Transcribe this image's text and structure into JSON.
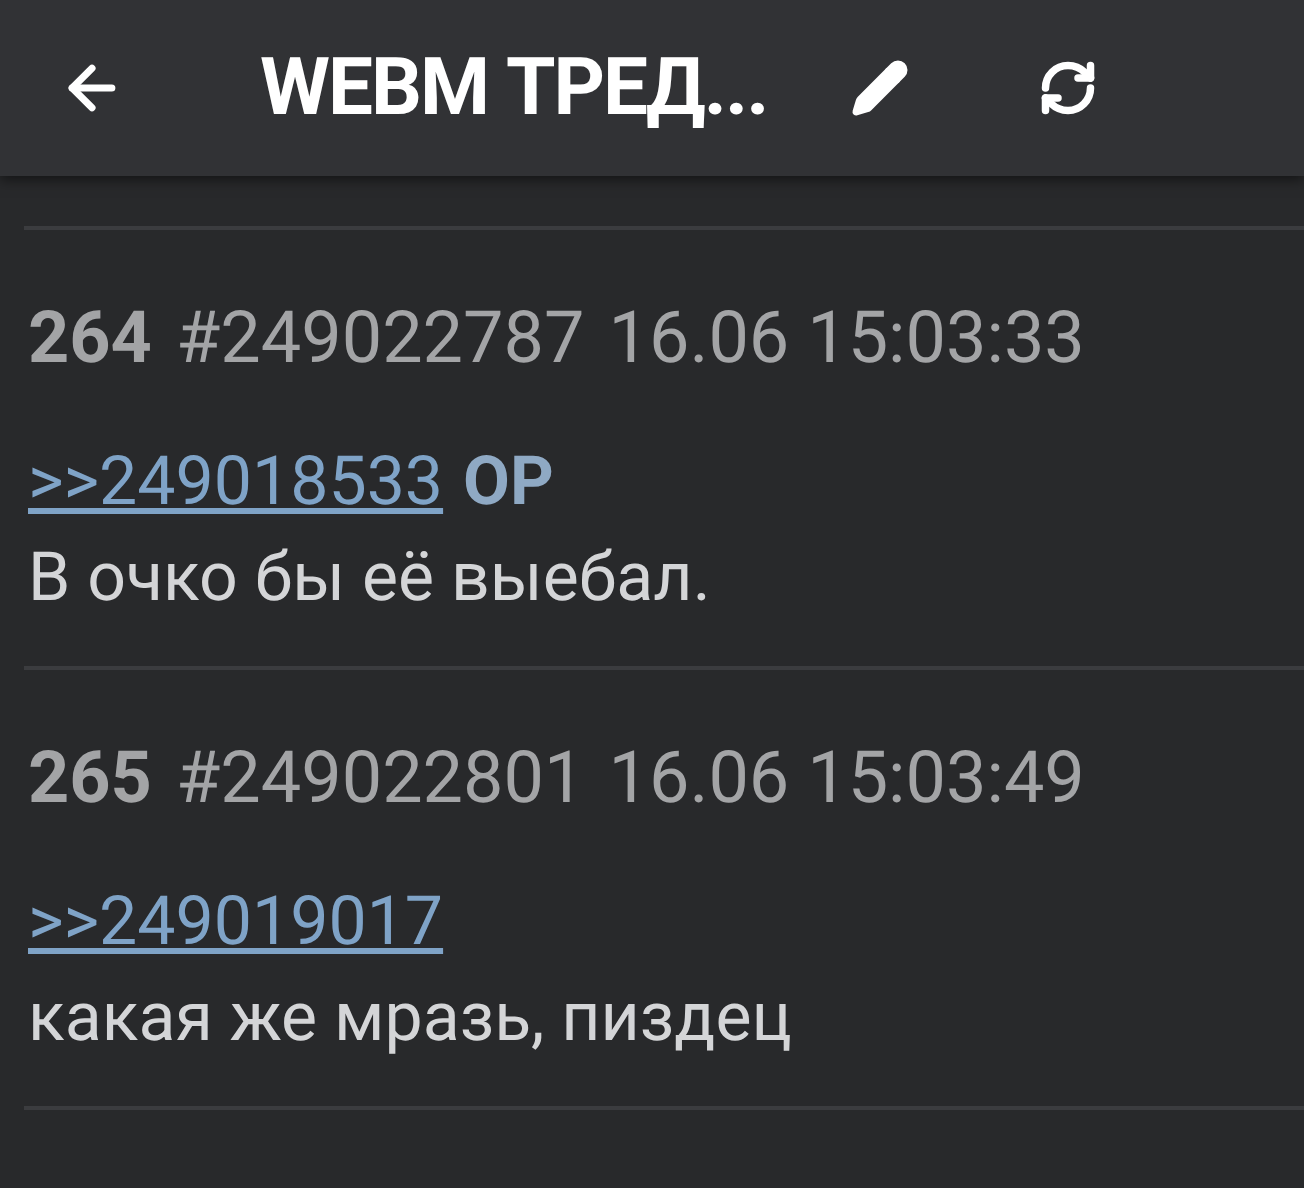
{
  "toolbar": {
    "title": "WEBM ТРЕД..."
  },
  "posts": [
    {
      "number": "264",
      "id": "#249022787",
      "date": "16.06 15:03:33",
      "reply_link": ">>249018533",
      "op_mark": "OP",
      "text": "В очко бы её выебал."
    },
    {
      "number": "265",
      "id": "#249022801",
      "date": "16.06 15:03:49",
      "reply_link": ">>249019017",
      "text": "какая же мразь, пиздец"
    }
  ]
}
